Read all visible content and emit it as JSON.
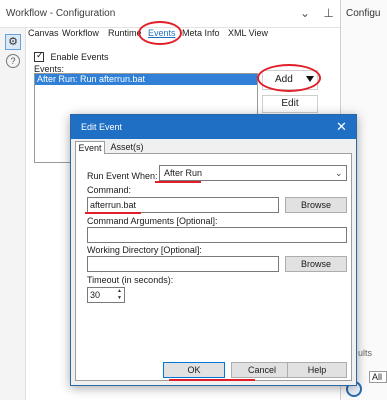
{
  "panel": {
    "title": "Workflow - Configuration",
    "controls": [
      "⌄",
      "⊥"
    ],
    "tabs": [
      {
        "label": "Canvas",
        "active": false
      },
      {
        "label": "Workflow",
        "active": false
      },
      {
        "label": "Runtime",
        "active": false
      },
      {
        "label": "Events",
        "active": true
      },
      {
        "label": "Meta Info",
        "active": false
      },
      {
        "label": "XML View",
        "active": false
      }
    ],
    "enable_events_label": "Enable Events",
    "enable_events_checked": true,
    "events_label": "Events:",
    "events": [
      "After Run: Run afterrun.bat"
    ],
    "add_label": "Add",
    "edit_label": "Edit",
    "icons": [
      "gear-icon",
      "help-icon"
    ]
  },
  "right_pane": {
    "title": "Configu",
    "bottom_text": "ults",
    "label_al": "All"
  },
  "dialog": {
    "title": "Edit Event",
    "close": "✕",
    "tabs": [
      "Event",
      "Asset(s)"
    ],
    "run_event_when_label": "Run Event When:",
    "run_event_when_value": "After Run",
    "command_label": "Command:",
    "command_value": "afterrun.bat",
    "browse_label": "Browse",
    "args_label": "Command Arguments [Optional]:",
    "args_value": "",
    "workdir_label": "Working Directory [Optional]:",
    "workdir_value": "",
    "timeout_label": "Timeout (in seconds):",
    "timeout_value": "30",
    "ok_label": "OK",
    "cancel_label": "Cancel",
    "help_label": "Help"
  },
  "annotation_color": "#e01f2a",
  "accent_color": "#1f6fc5"
}
